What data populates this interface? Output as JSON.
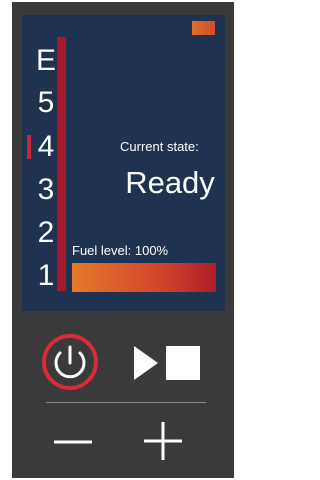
{
  "screen": {
    "gears": [
      "E",
      "5",
      "4",
      "3",
      "2",
      "1"
    ],
    "selected_gear": "4",
    "state_caption": "Current state:",
    "state_value": "Ready",
    "fuel_caption": "Fuel level: 100%",
    "fuel_level": 1.0
  },
  "controls": {
    "power_icon": "power-icon",
    "play_stop_icon": "play-stop-icon",
    "minus_icon": "minus-icon",
    "plus_icon": "plus-icon"
  },
  "colors": {
    "screen_bg": "#1f3350",
    "device_bg": "#3a3a3a",
    "gear_track": "#a8182b",
    "power_ring": "#d92b3a",
    "fuel_start": "#e4792d",
    "fuel_end": "#b01d2a"
  }
}
